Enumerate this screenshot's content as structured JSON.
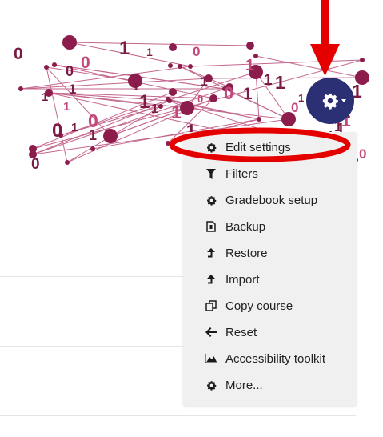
{
  "course_menu": {
    "settings_button_icon": "gear-icon",
    "items": [
      {
        "label": "Edit settings",
        "icon": "gear-icon"
      },
      {
        "label": "Filters",
        "icon": "filter-icon"
      },
      {
        "label": "Gradebook setup",
        "icon": "gear-icon"
      },
      {
        "label": "Backup",
        "icon": "file-backup-icon"
      },
      {
        "label": "Restore",
        "icon": "upload-arrow-icon"
      },
      {
        "label": "Import",
        "icon": "upload-arrow-icon"
      },
      {
        "label": "Copy course",
        "icon": "copy-icon"
      },
      {
        "label": "Reset",
        "icon": "arrow-left-icon"
      },
      {
        "label": "Accessibility toolkit",
        "icon": "chart-area-icon"
      },
      {
        "label": "More...",
        "icon": "gear-icon"
      }
    ]
  },
  "banner_binary_digits": [
    "0",
    "1",
    "1",
    "0",
    "1",
    "1",
    "0",
    "0",
    "1",
    "0",
    "1",
    "1",
    "1",
    "0",
    "1",
    "0",
    "1",
    "1",
    "0",
    "1",
    "0",
    "1",
    "1",
    "0",
    "1",
    "1",
    "1",
    "0",
    "1",
    "1",
    "0",
    "1",
    "1",
    "0",
    "0",
    "1",
    "1",
    "1",
    "0"
  ],
  "colors": {
    "banner_accent": "#a0195a",
    "settings_button": "#2b2f73",
    "annotation": "#e50000",
    "menu_background": "#f0f0f0"
  }
}
